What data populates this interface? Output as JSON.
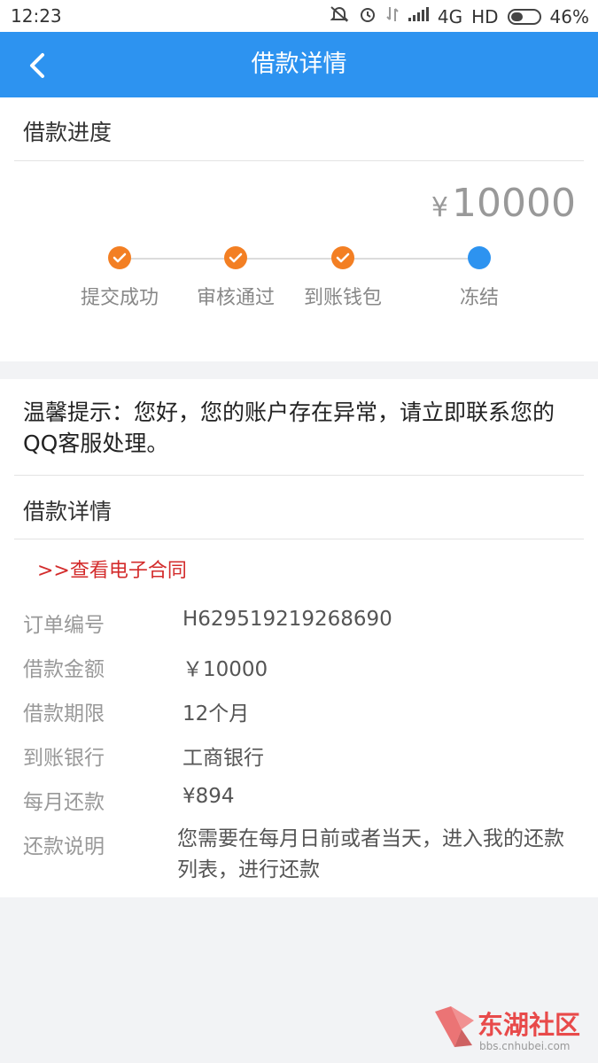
{
  "status_bar": {
    "time": "12:23",
    "network": "4G",
    "hd": "HD",
    "battery_percent": "46%",
    "battery_level": 0.46,
    "icons": [
      "mute-icon",
      "alarm-icon",
      "data-transfer-icon",
      "signal-icon",
      "battery-icon"
    ]
  },
  "header": {
    "title": "借款详情",
    "background_color": "#2d93f0"
  },
  "progress": {
    "section_title": "借款进度",
    "amount_currency": "¥",
    "amount_value": "10000",
    "steps": [
      {
        "label": "提交成功",
        "state": "done"
      },
      {
        "label": "审核通过",
        "state": "done"
      },
      {
        "label": "到账钱包",
        "state": "done"
      },
      {
        "label": "冻结",
        "state": "current"
      }
    ],
    "done_color": "#f37f23",
    "current_color": "#2d93f0"
  },
  "notice": {
    "text": "温馨提示：您好，您的账户存在异常，请立即联系您的QQ客服处理。"
  },
  "details": {
    "section_title": "借款详情",
    "contract_link": ">>查看电子合同",
    "link_color": "#d32b2b",
    "rows": [
      {
        "label": "订单编号",
        "value": "H629519219268690"
      },
      {
        "label": "借款金额",
        "value": "￥10000"
      },
      {
        "label": "借款期限",
        "value": "12个月"
      },
      {
        "label": "到账银行",
        "value": "工商银行"
      },
      {
        "label": "每月还款",
        "value": "¥894"
      },
      {
        "label": "还款说明",
        "value": "您需要在每月日前或者当天，进入我的还款列表，进行还款"
      }
    ]
  },
  "watermark": {
    "text": "东湖社区",
    "url": "bbs.cnhubei.com"
  }
}
